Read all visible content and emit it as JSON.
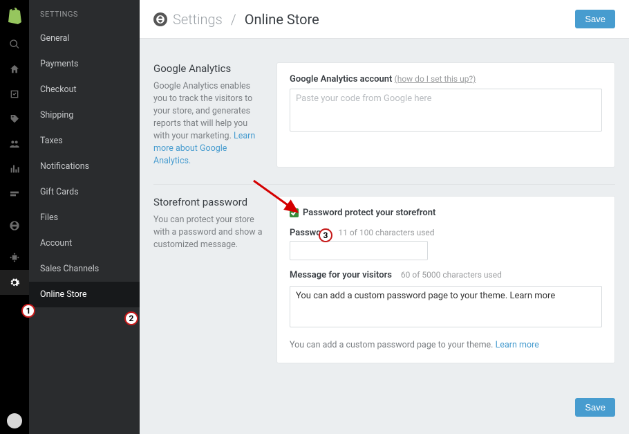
{
  "header": {
    "breadcrumb_root": "Settings",
    "breadcrumb_current": "Online Store",
    "save_label": "Save"
  },
  "sidebar": {
    "heading": "SETTINGS",
    "items": [
      {
        "label": "General"
      },
      {
        "label": "Payments"
      },
      {
        "label": "Checkout"
      },
      {
        "label": "Shipping"
      },
      {
        "label": "Taxes"
      },
      {
        "label": "Notifications"
      },
      {
        "label": "Gift Cards"
      },
      {
        "label": "Files"
      },
      {
        "label": "Account"
      },
      {
        "label": "Sales Channels"
      },
      {
        "label": "Online Store",
        "active": true
      }
    ]
  },
  "ga": {
    "title": "Google Analytics",
    "desc_a": "Google Analytics enables you to track the visitors to your store, and generates reports that will help you with your marketing. ",
    "learn_more": "Learn more about Google Analytics.",
    "account_label": "Google Analytics account",
    "setup_link": "(how do I set this up?)",
    "placeholder": "Paste your code from Google here"
  },
  "sp": {
    "title": "Storefront password",
    "desc": "You can protect your store with a password and show a customized message.",
    "checkbox_label": "Password protect your storefront",
    "checked": true,
    "password_label": "Password",
    "password_hint": "11 of 100 characters used",
    "password_value": "",
    "msg_label": "Message for your visitors",
    "msg_hint": "60 of 5000 characters used",
    "msg_value": "You can add a custom password page to your theme. Learn more",
    "note_text": "You can add a custom password page to your theme. ",
    "note_link": "Learn more"
  },
  "footer": {
    "save_label": "Save"
  },
  "annotations": {
    "a1": "1",
    "a2": "2",
    "a3": "3"
  }
}
